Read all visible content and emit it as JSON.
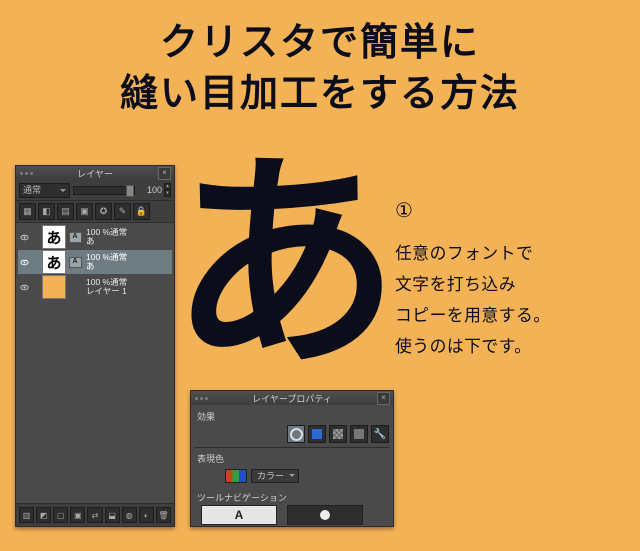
{
  "title": {
    "line1": "クリスタで簡単に",
    "line2": "縫い目加工をする方法"
  },
  "demo_glyph": "あ",
  "step_number": "①",
  "description": {
    "l1": "任意のフォントで",
    "l2": "文字を打ち込み",
    "l3": "コピーを用意する。",
    "l4": "使うのは下です。"
  },
  "layers_panel": {
    "title": "レイヤー",
    "blend_mode": "通常",
    "opacity_value": "100",
    "layers": [
      {
        "thumb_text": "あ",
        "name_line1": "100 %通常",
        "name_line2": "あ",
        "selected": false,
        "type": "text"
      },
      {
        "thumb_text": "あ",
        "name_line1": "100 %通常",
        "name_line2": "あ",
        "selected": true,
        "type": "text"
      },
      {
        "thumb_text": "",
        "name_line1": "100 %通常",
        "name_line2": "レイヤー 1",
        "selected": false,
        "type": "solid"
      }
    ]
  },
  "props_panel": {
    "title": "レイヤープロパティ",
    "section_effect": "効果",
    "section_color": "表現色",
    "color_mode": "カラー",
    "section_nav": "ツールナビゲーション",
    "nav_A": "A"
  }
}
